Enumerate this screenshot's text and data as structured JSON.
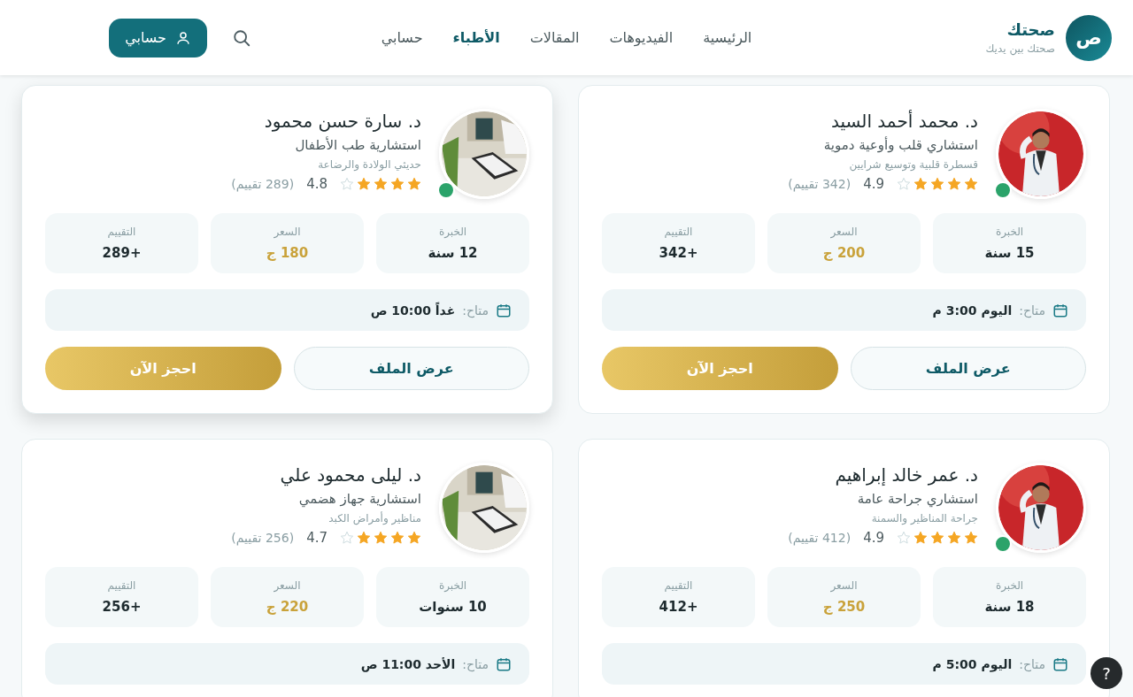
{
  "brand": {
    "logo_letter": "ص",
    "name": "صحتك",
    "tagline": "صحتك بين يديك"
  },
  "nav": [
    {
      "label": "الرئيسية",
      "selected": false
    },
    {
      "label": "الفيديوهات",
      "selected": false
    },
    {
      "label": "المقالات",
      "selected": false
    },
    {
      "label": "الأطباء",
      "selected": true
    },
    {
      "label": "حسابي",
      "selected": false
    }
  ],
  "account_button": "حسابي",
  "doctors": [
    {
      "name": "د. محمد أحمد السيد",
      "title": "استشاري قلب وأوعية دموية",
      "subspecialty": "قسطرة قلبية وتوسيع شرايين",
      "online": true,
      "stars": 4,
      "rating": "4.9",
      "reviews": "(342 تقييم)",
      "hovered": false,
      "stats": [
        {
          "label": "الخبرة",
          "value": "15 سنة",
          "kind": "plain"
        },
        {
          "label": "السعر",
          "value": "200 ج",
          "kind": "price"
        },
        {
          "label": "التقييم",
          "value": "+342",
          "kind": "plain"
        }
      ],
      "available_label": "متاح:",
      "available_time": "اليوم 3:00 م",
      "profile_button": "عرض الملف",
      "book_button": "احجز الآن"
    },
    {
      "name": "د. سارة حسن محمود",
      "title": "استشارية طب الأطفال",
      "subspecialty": "حديثي الولادة والرضاعة",
      "online": true,
      "stars": 4,
      "rating": "4.8",
      "reviews": "(289 تقييم)",
      "hovered": true,
      "stats": [
        {
          "label": "الخبرة",
          "value": "12 سنة",
          "kind": "plain"
        },
        {
          "label": "السعر",
          "value": "180 ج",
          "kind": "price"
        },
        {
          "label": "التقييم",
          "value": "+289",
          "kind": "plain"
        }
      ],
      "available_label": "متاح:",
      "available_time": "غداً 10:00 ص",
      "profile_button": "عرض الملف",
      "book_button": "احجز الآن"
    },
    {
      "name": "د. عمر خالد إبراهيم",
      "title": "استشاري جراحة عامة",
      "subspecialty": "جراحة المناظير والسمنة",
      "online": true,
      "stars": 4,
      "rating": "4.9",
      "reviews": "(412 تقييم)",
      "hovered": false,
      "stats": [
        {
          "label": "الخبرة",
          "value": "18 سنة",
          "kind": "plain"
        },
        {
          "label": "السعر",
          "value": "250 ج",
          "kind": "price"
        },
        {
          "label": "التقييم",
          "value": "+412",
          "kind": "plain"
        }
      ],
      "available_label": "متاح:",
      "available_time": "اليوم 5:00 م"
    },
    {
      "name": "د. ليلى محمود علي",
      "title": "استشارية جهاز هضمي",
      "subspecialty": "مناظير وأمراض الكبد",
      "online": false,
      "stars": 4,
      "rating": "4.7",
      "reviews": "(256 تقييم)",
      "hovered": false,
      "stats": [
        {
          "label": "الخبرة",
          "value": "10 سنوات",
          "kind": "plain"
        },
        {
          "label": "السعر",
          "value": "220 ج",
          "kind": "price"
        },
        {
          "label": "التقييم",
          "value": "+256",
          "kind": "plain"
        }
      ],
      "available_label": "متاح:",
      "available_time": "الأحد 11:00 ص"
    }
  ],
  "help_button": "?"
}
